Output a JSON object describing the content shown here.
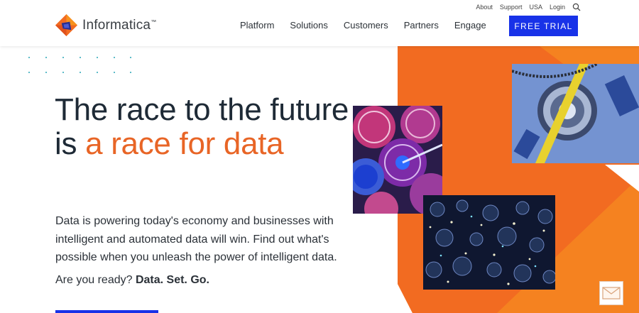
{
  "brand": {
    "name": "Informatica",
    "mark": "™"
  },
  "utility_nav": {
    "items": [
      {
        "label": "About"
      },
      {
        "label": "Support"
      },
      {
        "label": "USA"
      },
      {
        "label": "Login"
      }
    ],
    "search_icon": "search-icon"
  },
  "main_nav": {
    "items": [
      {
        "label": "Platform"
      },
      {
        "label": "Solutions"
      },
      {
        "label": "Customers"
      },
      {
        "label": "Partners"
      },
      {
        "label": "Engage"
      }
    ]
  },
  "cta": {
    "trial_label": "FREE TRIAL"
  },
  "hero": {
    "headline_part1": "The race to the future is ",
    "headline_accent": "a race for data",
    "body": "Data is powering today's economy and businesses with intelligent and automated data will win. Find out what's possible when you unleash the power of intelligent data.",
    "ready_prefix": "Are you ready? ",
    "ready_bold": "Data. Set. Go."
  },
  "colors": {
    "accent_orange": "#e86526",
    "brand_blue": "#1832e8",
    "dot_teal": "#2aa7b8"
  },
  "icons": {
    "chat": "envelope-icon"
  }
}
